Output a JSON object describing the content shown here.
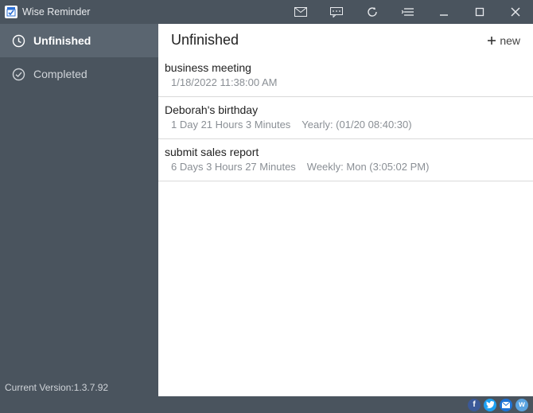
{
  "titlebar": {
    "title": "Wise Reminder"
  },
  "sidebar": {
    "items": [
      {
        "label": "Unfinished",
        "active": true
      },
      {
        "label": "Completed",
        "active": false
      }
    ],
    "version_prefix": "Current Version:",
    "version": "1.3.7.92"
  },
  "main": {
    "title": "Unfinished",
    "new_label": "new",
    "tasks": [
      {
        "title": "business meeting",
        "time": "1/18/2022 11:38:00 AM",
        "recurrence": ""
      },
      {
        "title": "Deborah's birthday",
        "time": "1 Day  21 Hours  3 Minutes",
        "recurrence": "Yearly: (01/20 08:40:30)"
      },
      {
        "title": "submit sales report",
        "time": "6 Days  3 Hours  27 Minutes",
        "recurrence": "Weekly: Mon (3:05:02 PM)"
      }
    ]
  },
  "colors": {
    "chrome": "#4a545e",
    "chrome_active": "#5a6570",
    "text_muted": "#8a8f95"
  }
}
